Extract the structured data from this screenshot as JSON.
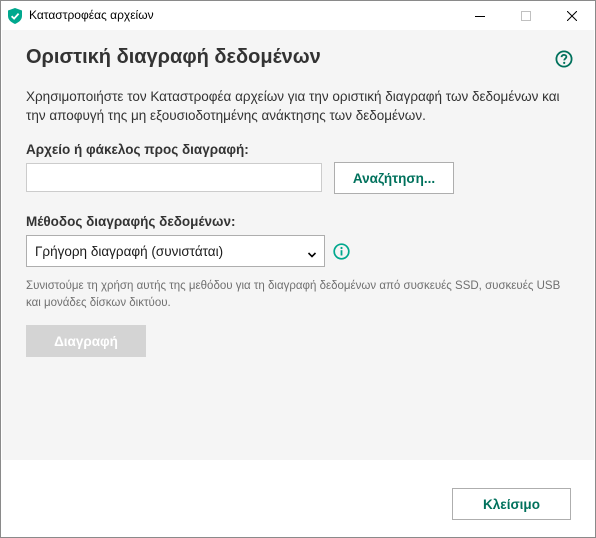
{
  "window": {
    "title": "Καταστροφέας αρχείων",
    "controls": [
      "minimize",
      "maximize",
      "close"
    ]
  },
  "main": {
    "heading": "Οριστική διαγραφή δεδομένων",
    "description": "Χρησιμοποιήστε τον Καταστροφέα αρχείων για την οριστική διαγραφή των δεδομένων και την αποφυγή της μη εξουσιοδοτημένης ανάκτησης των δεδομένων.",
    "file_label": "Αρχείο ή φάκελος προς διαγραφή:",
    "file_input": {
      "value": "",
      "placeholder": ""
    },
    "browse_label": "Αναζήτηση...",
    "method_label": "Μέθοδος διαγραφής δεδομένων:",
    "method_selected": "Γρήγορη διαγραφή (συνιστάται)",
    "hint": "Συνιστούμε τη χρήση αυτής της μεθόδου για τη διαγραφή δεδομένων από συσκευές SSD, συσκευές USB και μονάδες δίσκων δικτύου.",
    "delete_label": "Διαγραφή",
    "delete_enabled": false
  },
  "footer": {
    "close_label": "Κλείσιμο"
  },
  "colors": {
    "accent": "#00a88e",
    "accent_text": "#00715c",
    "content_bg": "#f5f5f5",
    "disabled_button": "#d4d4d4"
  },
  "icons": {
    "app": "kaspersky-shield-icon",
    "help": "help-question-icon",
    "info": "info-icon",
    "dropdown": "chevron-down-icon"
  }
}
